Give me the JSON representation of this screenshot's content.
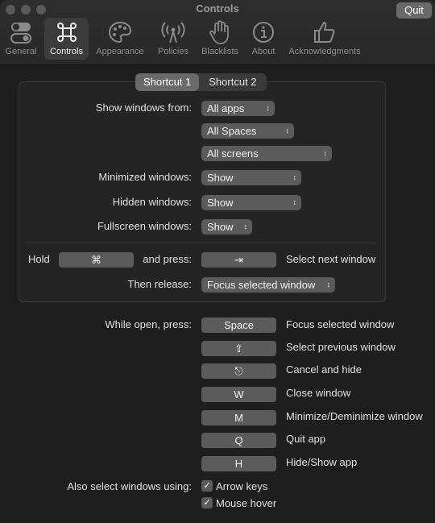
{
  "window": {
    "title": "Controls",
    "quit_label": "Quit"
  },
  "toolbar": {
    "tabs": [
      {
        "label": "General",
        "icon": "toggle-icon"
      },
      {
        "label": "Controls",
        "icon": "command-key-icon",
        "selected": true
      },
      {
        "label": "Appearance",
        "icon": "palette-icon"
      },
      {
        "label": "Policies",
        "icon": "antenna-icon"
      },
      {
        "label": "Blacklists",
        "icon": "hand-icon"
      },
      {
        "label": "About",
        "icon": "info-icon"
      },
      {
        "label": "Acknowledgments",
        "icon": "thumbs-up-icon"
      }
    ]
  },
  "shortcut_tabs": [
    "Shortcut 1",
    "Shortcut 2"
  ],
  "shortcut": {
    "show_windows_from_label": "Show windows from:",
    "apps_value": "All apps",
    "spaces_value": "All Spaces",
    "screens_value": "All screens",
    "minimized_label": "Minimized windows:",
    "minimized_value": "Show",
    "hidden_label": "Hidden windows:",
    "hidden_value": "Show",
    "fullscreen_label": "Fullscreen windows:",
    "fullscreen_value": "Show",
    "hold_label": "Hold",
    "hold_key": "⌘",
    "and_press_label": "and press:",
    "press_key": "⇥",
    "select_next_label": "Select next window",
    "then_release_label": "Then release:",
    "release_value": "Focus selected window"
  },
  "while_open": {
    "label": "While open, press:",
    "keys": [
      {
        "key": "Space",
        "action": "Focus selected window"
      },
      {
        "key": "⇧",
        "action": "Select previous window"
      },
      {
        "key": "⎋",
        "action": "Cancel and hide"
      },
      {
        "key": "W",
        "action": "Close window"
      },
      {
        "key": "M",
        "action": "Minimize/Deminimize window"
      },
      {
        "key": "Q",
        "action": "Quit app"
      },
      {
        "key": "H",
        "action": "Hide/Show app"
      }
    ]
  },
  "also_select": {
    "label": "Also select windows using:",
    "options": [
      {
        "label": "Arrow keys",
        "checked": true
      },
      {
        "label": "Mouse hover",
        "checked": true
      }
    ]
  },
  "colors": {
    "window_bg": "#1e1e1e",
    "control_bg": "#5b5b5b",
    "selected_tab_bg": "#3c3c3c"
  }
}
